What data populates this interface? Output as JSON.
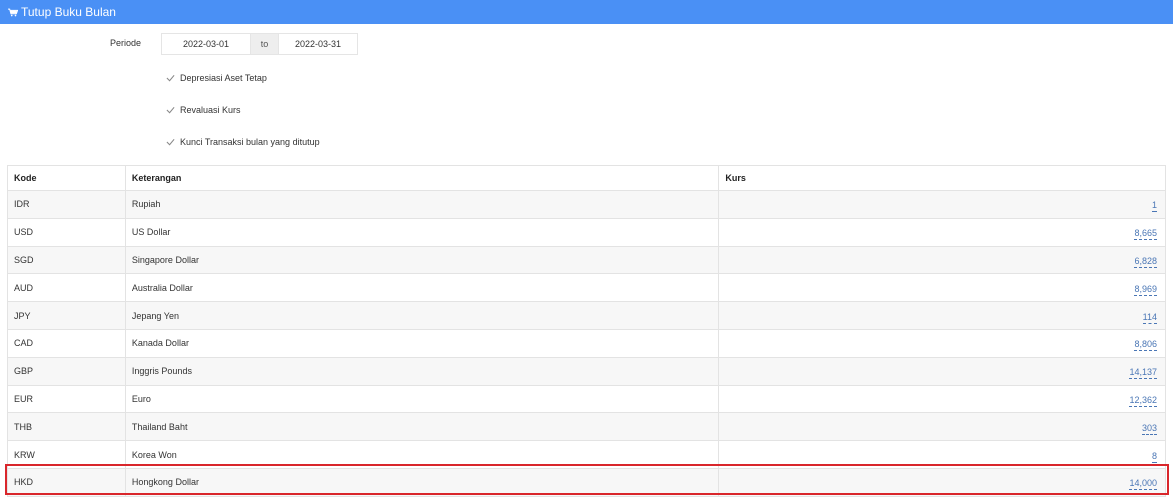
{
  "header": {
    "title": "Tutup Buku Bulan",
    "icon": "cart-icon"
  },
  "periode": {
    "label": "Periode",
    "start": "2022-03-01",
    "separator": "to",
    "end": "2022-03-31"
  },
  "options": [
    {
      "label": "Depresiasi Aset Tetap",
      "checked": true
    },
    {
      "label": "Revaluasi Kurs",
      "checked": true
    },
    {
      "label": "Kunci Transaksi bulan yang ditutup",
      "checked": true
    }
  ],
  "table": {
    "headers": [
      "Kode",
      "Keterangan",
      "Kurs"
    ],
    "rows": [
      {
        "kode": "IDR",
        "keterangan": "Rupiah",
        "kurs": "1"
      },
      {
        "kode": "USD",
        "keterangan": "US Dollar",
        "kurs": "8,665"
      },
      {
        "kode": "SGD",
        "keterangan": "Singapore Dollar",
        "kurs": "6,828"
      },
      {
        "kode": "AUD",
        "keterangan": "Australia Dollar",
        "kurs": "8,969"
      },
      {
        "kode": "JPY",
        "keterangan": "Jepang Yen",
        "kurs": "114"
      },
      {
        "kode": "CAD",
        "keterangan": "Kanada Dollar",
        "kurs": "8,806"
      },
      {
        "kode": "GBP",
        "keterangan": "Inggris Pounds",
        "kurs": "14,137"
      },
      {
        "kode": "EUR",
        "keterangan": "Euro",
        "kurs": "12,362"
      },
      {
        "kode": "THB",
        "keterangan": "Thailand Baht",
        "kurs": "303"
      },
      {
        "kode": "KRW",
        "keterangan": "Korea Won",
        "kurs": "8"
      },
      {
        "kode": "HKD",
        "keterangan": "Hongkong Dollar",
        "kurs": "14,000"
      }
    ]
  },
  "colors": {
    "header_bg": "#4a90f5",
    "link": "#4a76b5",
    "highlight": "#d9262b"
  }
}
